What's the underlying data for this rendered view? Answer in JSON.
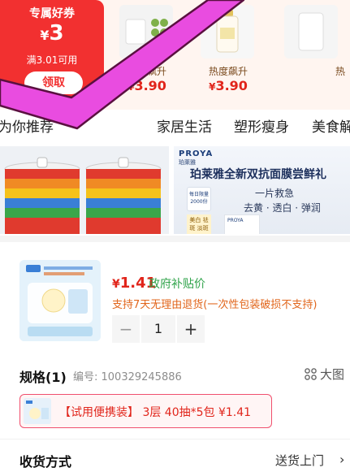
{
  "coupon": {
    "title": "专属好券",
    "currency": "¥",
    "amount": "3",
    "condition": "满3.01可用",
    "claim_label": "领取"
  },
  "promo_items": [
    {
      "label": "热度飙升",
      "currency": "¥",
      "price": "3.90"
    },
    {
      "label": "热度飙升",
      "currency": "¥",
      "price": "3.90"
    },
    {
      "label": "热",
      "currency": "",
      "price": ""
    }
  ],
  "category_tabs": [
    "为你推荐",
    "家居生活",
    "塑形瘦身",
    "美食解馋"
  ],
  "banner_right": {
    "brand": "PROYA",
    "brand_cn": "珀莱雅",
    "title": "珀莱雅全新双抗面膜尝鲜礼",
    "subtitle_1": "一片救急",
    "subtitle_2": "去黄 · 透白 · 弹润",
    "badge": "每日限量 2000份",
    "tag": "美白 祛斑 淡斑"
  },
  "product": {
    "currency": "¥",
    "price": "1.41",
    "subsidy_label": "政府补贴价",
    "return_policy": "支持7天无理由退货(一次性包装破损不支持)",
    "quantity": "1",
    "minus_label": "−",
    "plus_label": "+"
  },
  "specs": {
    "heading": "规格(1)",
    "sku_label": "编号: 100329245886",
    "big_view_label": "大图",
    "option_label": "【试用便携装】 3层 40抽*5包  ¥1.41"
  },
  "delivery": {
    "heading": "收货方式",
    "value": "送货上门",
    "chevron": "›"
  },
  "colors": {
    "accent_red": "#e1251b",
    "coupon_red": "#f23030",
    "subsidy_green": "#2fa34a",
    "overlay_check": "#e94ce0"
  }
}
